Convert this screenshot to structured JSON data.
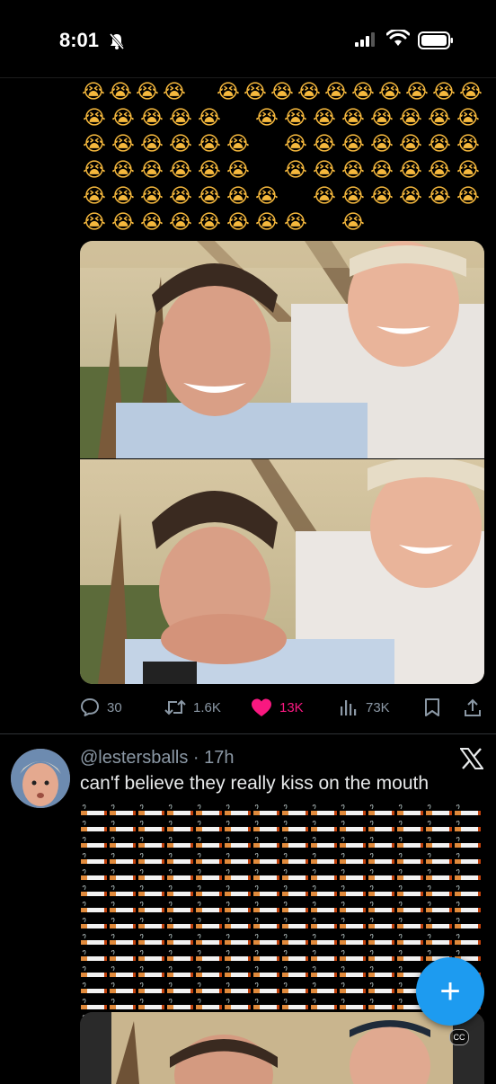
{
  "status_bar": {
    "time": "8:01"
  },
  "tweet1": {
    "reply_count": "30",
    "retweet_count": "1.6K",
    "like_count": "13K",
    "view_count": "73K"
  },
  "tweet2": {
    "handle_time": "@lestersballs · 17h",
    "text": "can'f believe they really kiss on the mouth",
    "emoji_name": "cigarette-emoji"
  },
  "emoji_rows": [
    [
      "😭",
      "😭",
      "😭",
      "😭",
      "",
      "😭",
      "😭",
      "😭",
      "😭",
      "😭",
      "😭",
      "😭",
      "😭",
      "😭",
      "😭"
    ],
    [
      "😭",
      "😭",
      "😭",
      "😭",
      "😭",
      "",
      "😭",
      "😭",
      "😭",
      "😭",
      "😭",
      "😭",
      "😭",
      "😭"
    ],
    [
      "😭",
      "😭",
      "😭",
      "😭",
      "😭",
      "😭",
      "",
      "😭",
      "😭",
      "😭",
      "😭",
      "😭",
      "😭",
      "😭"
    ],
    [
      "😭",
      "😭",
      "😭",
      "😭",
      "😭",
      "😭",
      "",
      "😭",
      "😭",
      "😭",
      "😭",
      "😭",
      "😭",
      "😭"
    ],
    [
      "😭",
      "😭",
      "😭",
      "😭",
      "😭",
      "😭",
      "😭",
      "",
      "😭",
      "😭",
      "😭",
      "😭",
      "😭",
      "😭"
    ],
    [
      "😭",
      "😭",
      "😭",
      "😭",
      "😭",
      "😭",
      "😭",
      "😭",
      "",
      "😭"
    ]
  ],
  "cig_rows": [
    14,
    14,
    14,
    14,
    14,
    14,
    14,
    14,
    14,
    14,
    14,
    14,
    14,
    8
  ],
  "colors": {
    "like": "#f91880",
    "accent": "#1d9bf0",
    "muted": "#8b98a5"
  },
  "fab": {
    "label": "+"
  },
  "cc": {
    "label": "CC"
  }
}
